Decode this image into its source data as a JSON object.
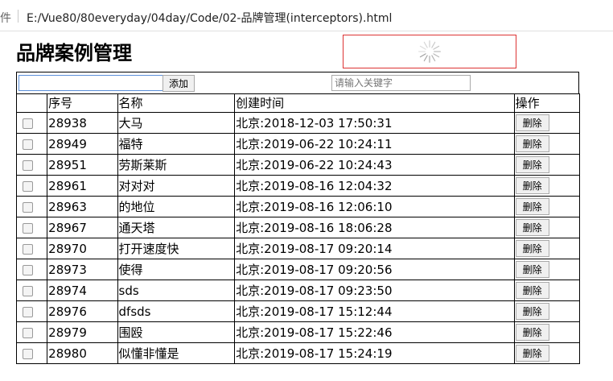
{
  "browser": {
    "prefix": "件",
    "url": "E:/Vue80/80everyday/04day/Code/02-品牌管理(interceptors).html"
  },
  "page": {
    "title": "品牌案例管理",
    "add_label": "添加",
    "name_value": "",
    "search_placeholder": "请输入关键字"
  },
  "table": {
    "headers": {
      "check": "",
      "id": "序号",
      "name": "名称",
      "time": "创建时间",
      "op": "操作"
    },
    "delete_label": "删除",
    "rows": [
      {
        "id": "28938",
        "name": "大马",
        "time": "北京:2018-12-03 17:50:31"
      },
      {
        "id": "28949",
        "name": "福特",
        "time": "北京:2019-06-22 10:24:11"
      },
      {
        "id": "28951",
        "name": "劳斯莱斯",
        "time": "北京:2019-06-22 10:24:43"
      },
      {
        "id": "28961",
        "name": "对对对",
        "time": "北京:2019-08-16 12:04:32"
      },
      {
        "id": "28963",
        "name": "的地位",
        "time": "北京:2019-08-16 12:06:10"
      },
      {
        "id": "28967",
        "name": "通天塔",
        "time": "北京:2019-08-16 18:06:28"
      },
      {
        "id": "28970",
        "name": "打开速度快",
        "time": "北京:2019-08-17 09:20:14"
      },
      {
        "id": "28973",
        "name": "使得",
        "time": "北京:2019-08-17 09:20:56"
      },
      {
        "id": "28974",
        "name": "sds",
        "time": "北京:2019-08-17 09:23:50"
      },
      {
        "id": "28976",
        "name": "dfsds",
        "time": "北京:2019-08-17 15:12:44"
      },
      {
        "id": "28979",
        "name": "围殴",
        "time": "北京:2019-08-17 15:22:46"
      },
      {
        "id": "28980",
        "name": "似懂非懂是",
        "time": "北京:2019-08-17 15:24:19"
      }
    ]
  },
  "colors": {
    "loading_border": "#dd3333",
    "input_focus": "#5b8fd9"
  },
  "icons": {
    "loading": "spinner-icon"
  }
}
